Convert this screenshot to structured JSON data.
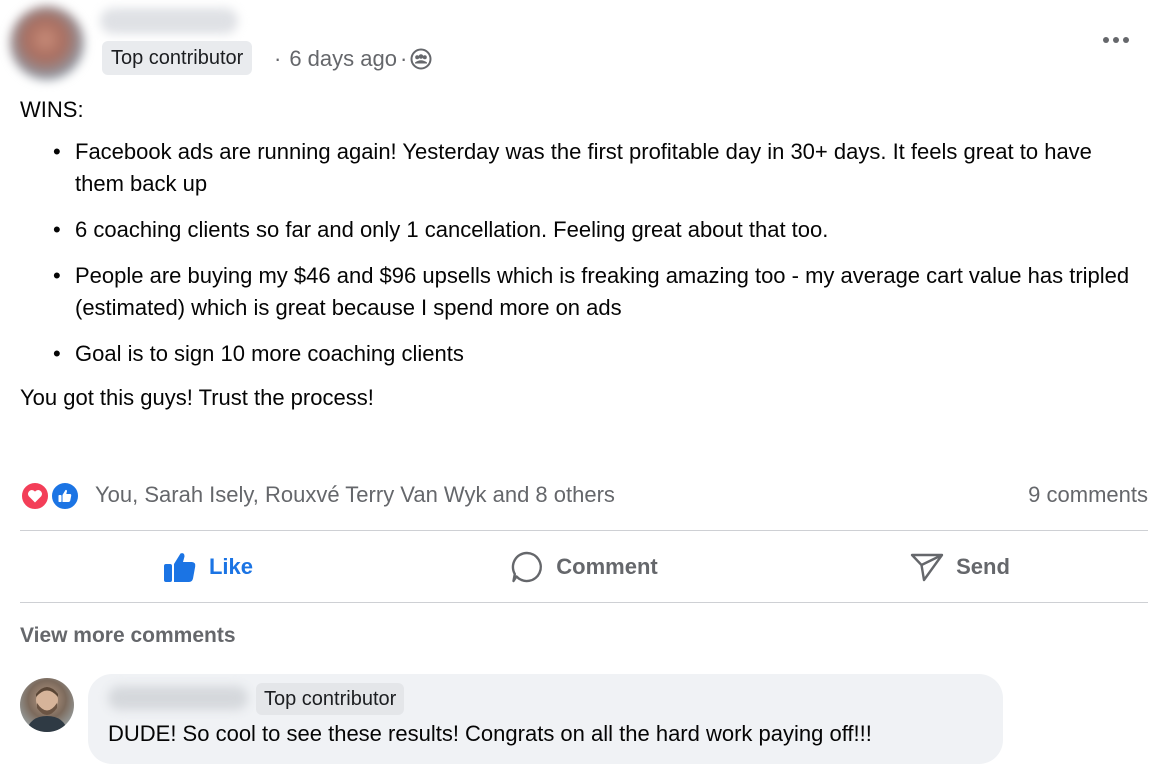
{
  "post": {
    "author_badge": "Top contributor",
    "separator": "·",
    "time": "6 days ago",
    "separator_2": "·",
    "privacy_icon": "group-icon",
    "body": {
      "heading": "WINS:",
      "items": [
        "Facebook ads are running again! Yesterday was the first profitable day in 30+ days. It feels great to have them back up",
        "6 coaching clients so far and only 1 cancellation. Feeling great about that too.",
        "People are buying my $46 and $96 upsells which is freaking amazing too - my average cart value has tripled (estimated) which is great because I spend more on ads",
        "Goal is to sign 10 more coaching clients"
      ],
      "closing": "You got this guys! Trust the process!"
    }
  },
  "reactions": {
    "icons": [
      "love-reaction-icon",
      "like-reaction-icon"
    ],
    "names": "You, Sarah Isely, Rouxvé Terry Van Wyk and 8 others",
    "comments_count": "9 comments"
  },
  "actions": {
    "like": "Like",
    "comment": "Comment",
    "send": "Send"
  },
  "comments": {
    "view_more": "View more comments",
    "items": [
      {
        "badge": "Top contributor",
        "text": "DUDE! So cool to see these results! Congrats on all the hard work paying off!!!"
      }
    ]
  },
  "colors": {
    "accent": "#1b74e4",
    "secondary_text": "#65676b",
    "bubble": "#f0f2f5",
    "love": "#f33e58"
  }
}
